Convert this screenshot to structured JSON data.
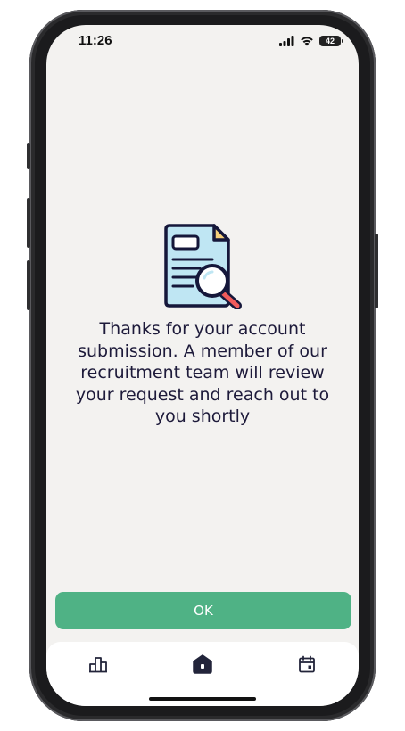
{
  "status_bar": {
    "time": "11:26",
    "battery": "42"
  },
  "main": {
    "icon": "document-search-icon",
    "message_lines": [
      "Thanks for your account",
      "submission. A member of our",
      "recruitment team will review",
      "your request and reach out to",
      "you shortly"
    ]
  },
  "ok_button": {
    "label": "OK",
    "color": "#4fb285"
  },
  "tab_bar": {
    "items": [
      {
        "icon": "chart-icon"
      },
      {
        "icon": "home-icon"
      },
      {
        "icon": "calendar-icon"
      }
    ]
  },
  "colors": {
    "background": "#f3f2f0",
    "text": "#1d1a3a",
    "accent": "#4fb285"
  }
}
